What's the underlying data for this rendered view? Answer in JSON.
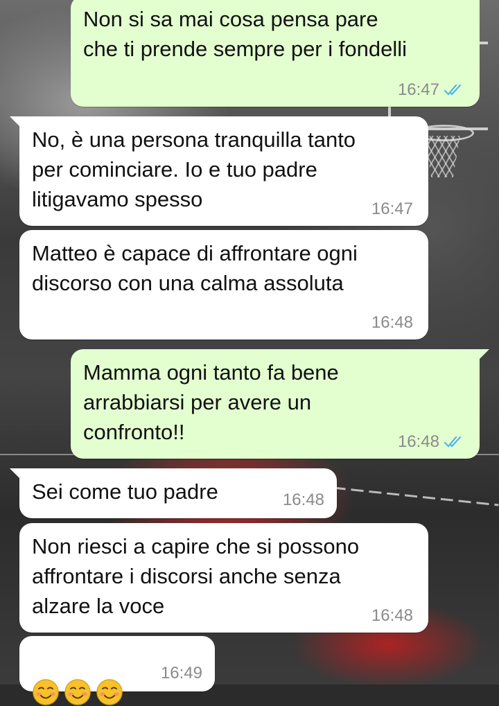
{
  "colors": {
    "incoming_bubble": "#ffffff",
    "outgoing_bubble": "#e3ffd0",
    "read_ticks": "#4fb6ec",
    "timestamp": "#8a8a8a"
  },
  "messages": [
    {
      "direction": "out",
      "text": "Non si sa mai cosa pensa pare\nche ti prende sempre per i fondelli",
      "time": "16:47",
      "status": "read"
    },
    {
      "direction": "in",
      "text": "No, è una persona tranquilla tanto\nper cominciare. Io e tuo padre\nlitigavamo spesso",
      "time": "16:47"
    },
    {
      "direction": "in",
      "text": "Matteo è capace di affrontare ogni\ndiscorso con una calma assoluta",
      "time": "16:48"
    },
    {
      "direction": "out",
      "text": "Mamma ogni tanto fa bene\narrabbiarsi per avere un\nconfronto!!",
      "time": "16:48",
      "status": "read"
    },
    {
      "direction": "in",
      "text": "Sei come tuo padre",
      "time": "16:48"
    },
    {
      "direction": "in",
      "text": "Non riesci a capire che si possono\naffrontare i discorsi anche senza\nalzare la voce",
      "time": "16:48"
    },
    {
      "direction": "in",
      "text": "",
      "emoji": [
        "smiling-face-icon",
        "smiling-face-icon",
        "smiling-face-icon"
      ],
      "time": "16:49"
    }
  ]
}
